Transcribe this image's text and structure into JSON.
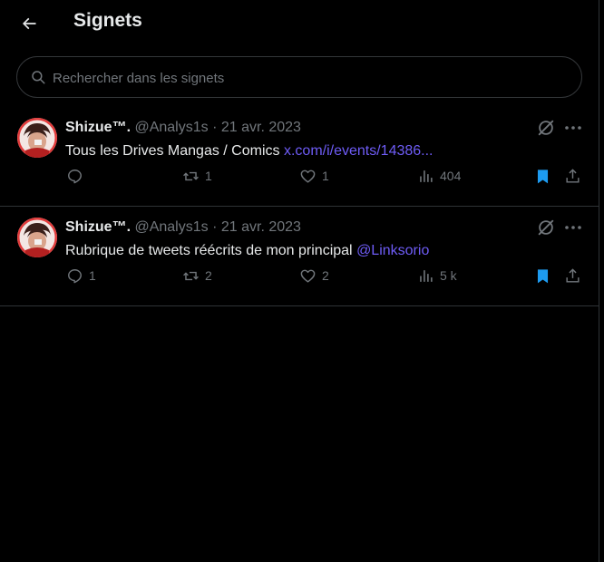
{
  "header": {
    "title": "Signets"
  },
  "search": {
    "placeholder": "Rechercher dans les signets"
  },
  "colors": {
    "background": "#000000",
    "text": "#e7e9ea",
    "muted": "#71767b",
    "link": "#6e5cf6",
    "bookmark": "#1d9bf0",
    "border": "#2f3336"
  },
  "tweets": [
    {
      "author_name": "Shizue™.",
      "handle": "@Analys1s",
      "separator": "·",
      "date": "21 avr. 2023",
      "text": "Tous les Drives Mangas / Comics",
      "link": "x.com/i/events/14386...",
      "replies": "",
      "retweets": "1",
      "likes": "1",
      "views": "404",
      "bookmarked": true
    },
    {
      "author_name": "Shizue™.",
      "handle": "@Analys1s",
      "separator": "·",
      "date": "21 avr. 2023",
      "text": "Rubrique de tweets réécrits de mon principal",
      "link": "@Linksorio",
      "replies": "1",
      "retweets": "2",
      "likes": "2",
      "views": "5 k",
      "bookmarked": true
    }
  ]
}
